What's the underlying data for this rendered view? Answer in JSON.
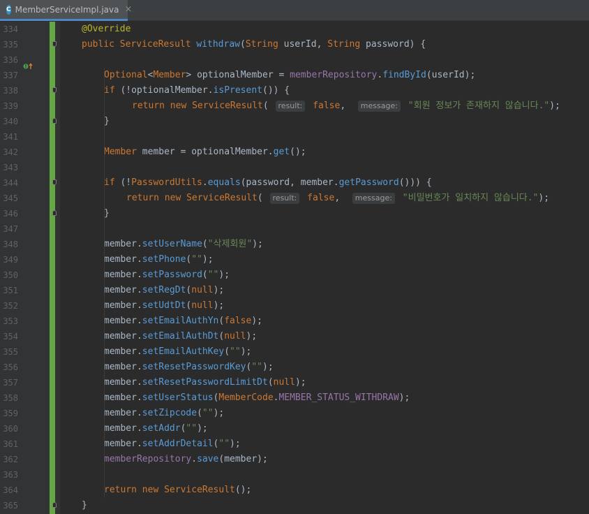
{
  "tab": {
    "title": "MemberServiceImpl.java",
    "icon_letter": "C",
    "close_glyph": "×"
  },
  "lines": [
    {
      "n": "334",
      "text": "@Override"
    },
    {
      "n": "335",
      "text": "public ServiceResult withdraw(String userId, String password) {"
    },
    {
      "n": "336",
      "text": ""
    },
    {
      "n": "337",
      "text": "Optional<Member> optionalMember = memberRepository.findById(userId);"
    },
    {
      "n": "338",
      "text": "if (!optionalMember.isPresent()) {"
    },
    {
      "n": "339",
      "text": "return new ServiceResult( result: false,  message: \"회원 정보가 존재하지 않습니다.\");"
    },
    {
      "n": "340",
      "text": "}"
    },
    {
      "n": "341",
      "text": ""
    },
    {
      "n": "342",
      "text": "Member member = optionalMember.get();"
    },
    {
      "n": "343",
      "text": ""
    },
    {
      "n": "344",
      "text": "if (!PasswordUtils.equals(password, member.getPassword())) {"
    },
    {
      "n": "345",
      "text": "return new ServiceResult( result: false,  message: \"비밀번호가 일치하지 않습니다.\");"
    },
    {
      "n": "346",
      "text": "}"
    },
    {
      "n": "347",
      "text": ""
    },
    {
      "n": "348",
      "text": "member.setUserName(\"삭제회원\");"
    },
    {
      "n": "349",
      "text": "member.setPhone(\"\");"
    },
    {
      "n": "350",
      "text": "member.setPassword(\"\");"
    },
    {
      "n": "351",
      "text": "member.setRegDt(null);"
    },
    {
      "n": "352",
      "text": "member.setUdtDt(null);"
    },
    {
      "n": "353",
      "text": "member.setEmailAuthYn(false);"
    },
    {
      "n": "354",
      "text": "member.setEmailAuthDt(null);"
    },
    {
      "n": "355",
      "text": "member.setEmailAuthKey(\"\");"
    },
    {
      "n": "356",
      "text": "member.setResetPasswordKey(\"\");"
    },
    {
      "n": "357",
      "text": "member.setResetPasswordLimitDt(null);"
    },
    {
      "n": "358",
      "text": "member.setUserStatus(MemberCode.MEMBER_STATUS_WITHDRAW);"
    },
    {
      "n": "359",
      "text": "member.setZipcode(\"\");"
    },
    {
      "n": "360",
      "text": "member.setAddr(\"\");"
    },
    {
      "n": "361",
      "text": "member.setAddrDetail(\"\");"
    },
    {
      "n": "362",
      "text": "memberRepository.save(member);"
    },
    {
      "n": "363",
      "text": ""
    },
    {
      "n": "364",
      "text": "return new ServiceResult();"
    },
    {
      "n": "365",
      "text": "}"
    }
  ],
  "colors": {
    "background": "#2b2b2b",
    "gutter": "#313335",
    "vcs_modified": "#64a843",
    "keyword": "#cc7832",
    "annotation": "#bbb529",
    "method": "#5a9bd6",
    "field": "#9876aa",
    "string": "#6a8759",
    "default_text": "#a9b7c6"
  }
}
